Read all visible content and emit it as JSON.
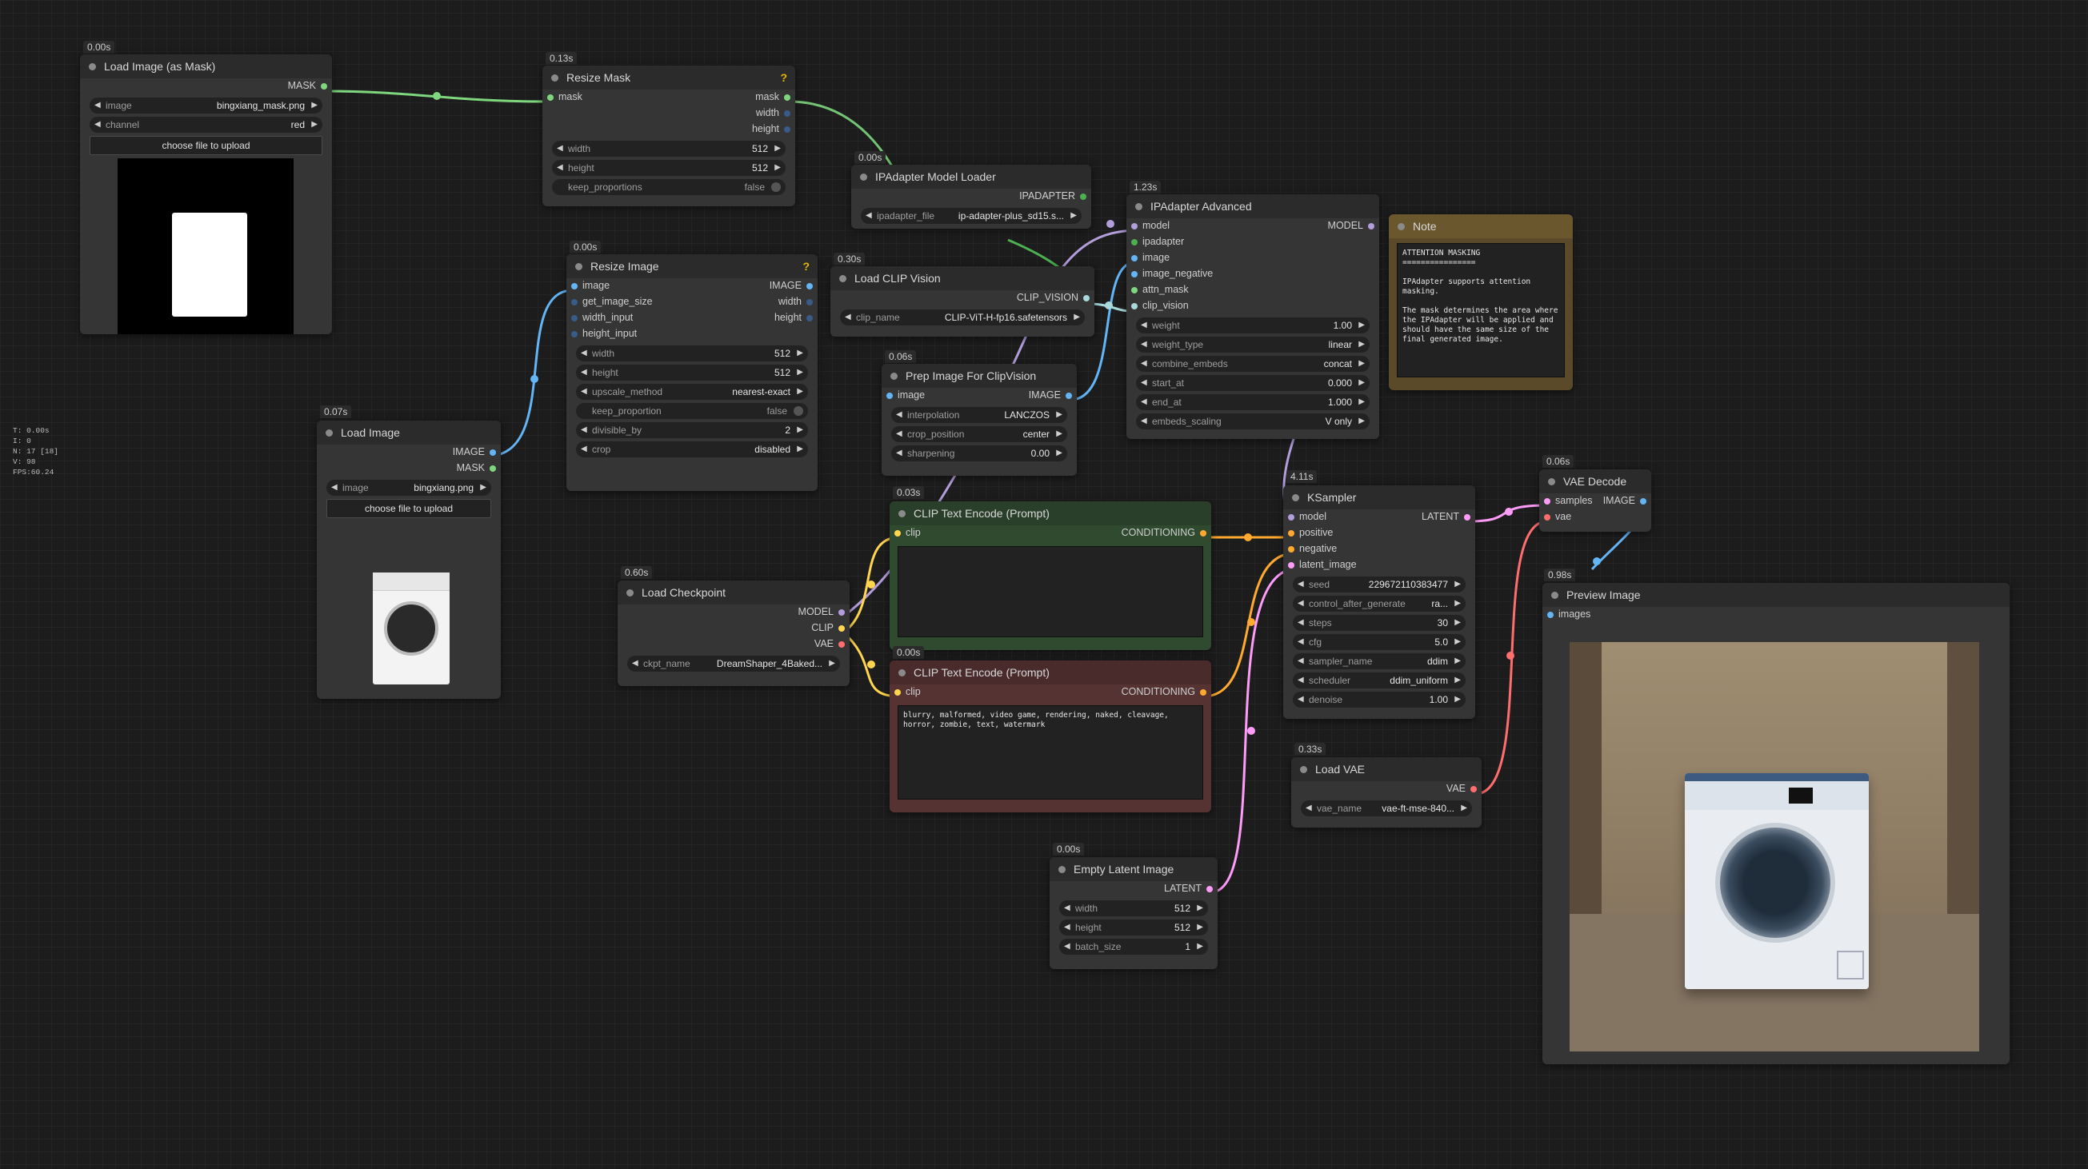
{
  "colors": {
    "mask": "#7ed67e",
    "image": "#64b5f6",
    "model": "#b39ddb",
    "clip": "#ffd54f",
    "vae": "#ff6e6e",
    "latent": "#ff9cf9",
    "conditioning": "#ffa931",
    "ipadapter": "#4caf50",
    "clip_vision": "#a8dadc",
    "note": "#5a4a2a"
  },
  "stats": [
    "T: 0.00s",
    "I: 0",
    "N: 17 [18]",
    "V: 98",
    "FPS:60.24"
  ],
  "nodes": {
    "load_mask": {
      "timing": "0.00s",
      "title": "Load Image (as Mask)",
      "out": "MASK",
      "image_label": "image",
      "image_value": "bingxiang_mask.png",
      "channel_label": "channel",
      "channel_value": "red",
      "upload": "choose file to upload"
    },
    "resize_mask": {
      "timing": "0.13s",
      "title": "Resize Mask",
      "in": "mask",
      "out1": "mask",
      "out2": "width",
      "out3": "height",
      "w1_label": "width",
      "w1_value": "512",
      "w2_label": "height",
      "w2_value": "512",
      "w3_label": "keep_proportions",
      "w3_value": "false"
    },
    "ipa_loader": {
      "timing": "0.00s",
      "title": "IPAdapter Model Loader",
      "out": "IPADAPTER",
      "w_label": "ipadapter_file",
      "w_value": "ip-adapter-plus_sd15.s..."
    },
    "ipa_adv": {
      "timing": "1.23s",
      "title": "IPAdapter Advanced",
      "in": [
        "model",
        "ipadapter",
        "image",
        "image_negative",
        "attn_mask",
        "clip_vision"
      ],
      "out": "MODEL",
      "widgets": [
        {
          "label": "weight",
          "value": "1.00"
        },
        {
          "label": "weight_type",
          "value": "linear"
        },
        {
          "label": "combine_embeds",
          "value": "concat"
        },
        {
          "label": "start_at",
          "value": "0.000"
        },
        {
          "label": "end_at",
          "value": "1.000"
        },
        {
          "label": "embeds_scaling",
          "value": "V only"
        }
      ]
    },
    "note": {
      "title": "Note",
      "text": "ATTENTION MASKING\n================\n\nIPAdapter supports attention masking.\n\nThe mask determines the area where the IPAdapter will be applied and should have the same size of the final generated image."
    },
    "resize_image": {
      "timing": "0.00s",
      "title": "Resize Image",
      "in": [
        "image",
        "get_image_size",
        "width_input",
        "height_input"
      ],
      "out": [
        "IMAGE",
        "width",
        "height"
      ],
      "widgets": [
        {
          "label": "width",
          "value": "512"
        },
        {
          "label": "height",
          "value": "512"
        },
        {
          "label": "upscale_method",
          "value": "nearest-exact"
        },
        {
          "label": "keep_proportion",
          "value": "false",
          "toggle": true
        },
        {
          "label": "divisible_by",
          "value": "2"
        },
        {
          "label": "crop",
          "value": "disabled"
        }
      ]
    },
    "load_clip_vision": {
      "timing": "0.30s",
      "title": "Load CLIP Vision",
      "out": "CLIP_VISION",
      "w_label": "clip_name",
      "w_value": "CLIP-ViT-H-fp16.safetensors"
    },
    "prep_image": {
      "timing": "0.06s",
      "title": "Prep Image For ClipVision",
      "in": "image",
      "out": "IMAGE",
      "widgets": [
        {
          "label": "interpolation",
          "value": "LANCZOS"
        },
        {
          "label": "crop_position",
          "value": "center"
        },
        {
          "label": "sharpening",
          "value": "0.00"
        }
      ]
    },
    "load_image": {
      "timing": "0.07s",
      "title": "Load Image",
      "out1": "IMAGE",
      "out2": "MASK",
      "image_label": "image",
      "image_value": "bingxiang.png",
      "upload": "choose file to upload"
    },
    "clip_pos": {
      "timing": "0.03s",
      "title": "CLIP Text Encode (Prompt)",
      "in": "clip",
      "out": "CONDITIONING",
      "text": ""
    },
    "clip_neg": {
      "timing": "0.00s",
      "title": "CLIP Text Encode (Prompt)",
      "in": "clip",
      "out": "CONDITIONING",
      "text": "blurry, malformed, video game, rendering, naked, cleavage, horror, zombie, text, watermark"
    },
    "load_ckpt": {
      "timing": "0.60s",
      "title": "Load Checkpoint",
      "out": [
        "MODEL",
        "CLIP",
        "VAE"
      ],
      "w_label": "ckpt_name",
      "w_value": "DreamShaper_4Baked..."
    },
    "ksampler": {
      "timing": "4.11s",
      "title": "KSampler",
      "in": [
        "model",
        "positive",
        "negative",
        "latent_image"
      ],
      "out": "LATENT",
      "widgets": [
        {
          "label": "seed",
          "value": "229672110383477"
        },
        {
          "label": "control_after_generate",
          "value": "ra..."
        },
        {
          "label": "steps",
          "value": "30"
        },
        {
          "label": "cfg",
          "value": "5.0"
        },
        {
          "label": "sampler_name",
          "value": "ddim"
        },
        {
          "label": "scheduler",
          "value": "ddim_uniform"
        },
        {
          "label": "denoise",
          "value": "1.00"
        }
      ]
    },
    "load_vae": {
      "timing": "0.33s",
      "title": "Load VAE",
      "out": "VAE",
      "w_label": "vae_name",
      "w_value": "vae-ft-mse-840..."
    },
    "empty_latent": {
      "timing": "0.00s",
      "title": "Empty Latent Image",
      "out": "LATENT",
      "widgets": [
        {
          "label": "width",
          "value": "512"
        },
        {
          "label": "height",
          "value": "512"
        },
        {
          "label": "batch_size",
          "value": "1"
        }
      ]
    },
    "vae_decode": {
      "timing": "0.06s",
      "title": "VAE Decode",
      "in": [
        "samples",
        "vae"
      ],
      "out": "IMAGE"
    },
    "preview": {
      "timing": "0.98s",
      "title": "Preview Image",
      "in": "images"
    }
  }
}
